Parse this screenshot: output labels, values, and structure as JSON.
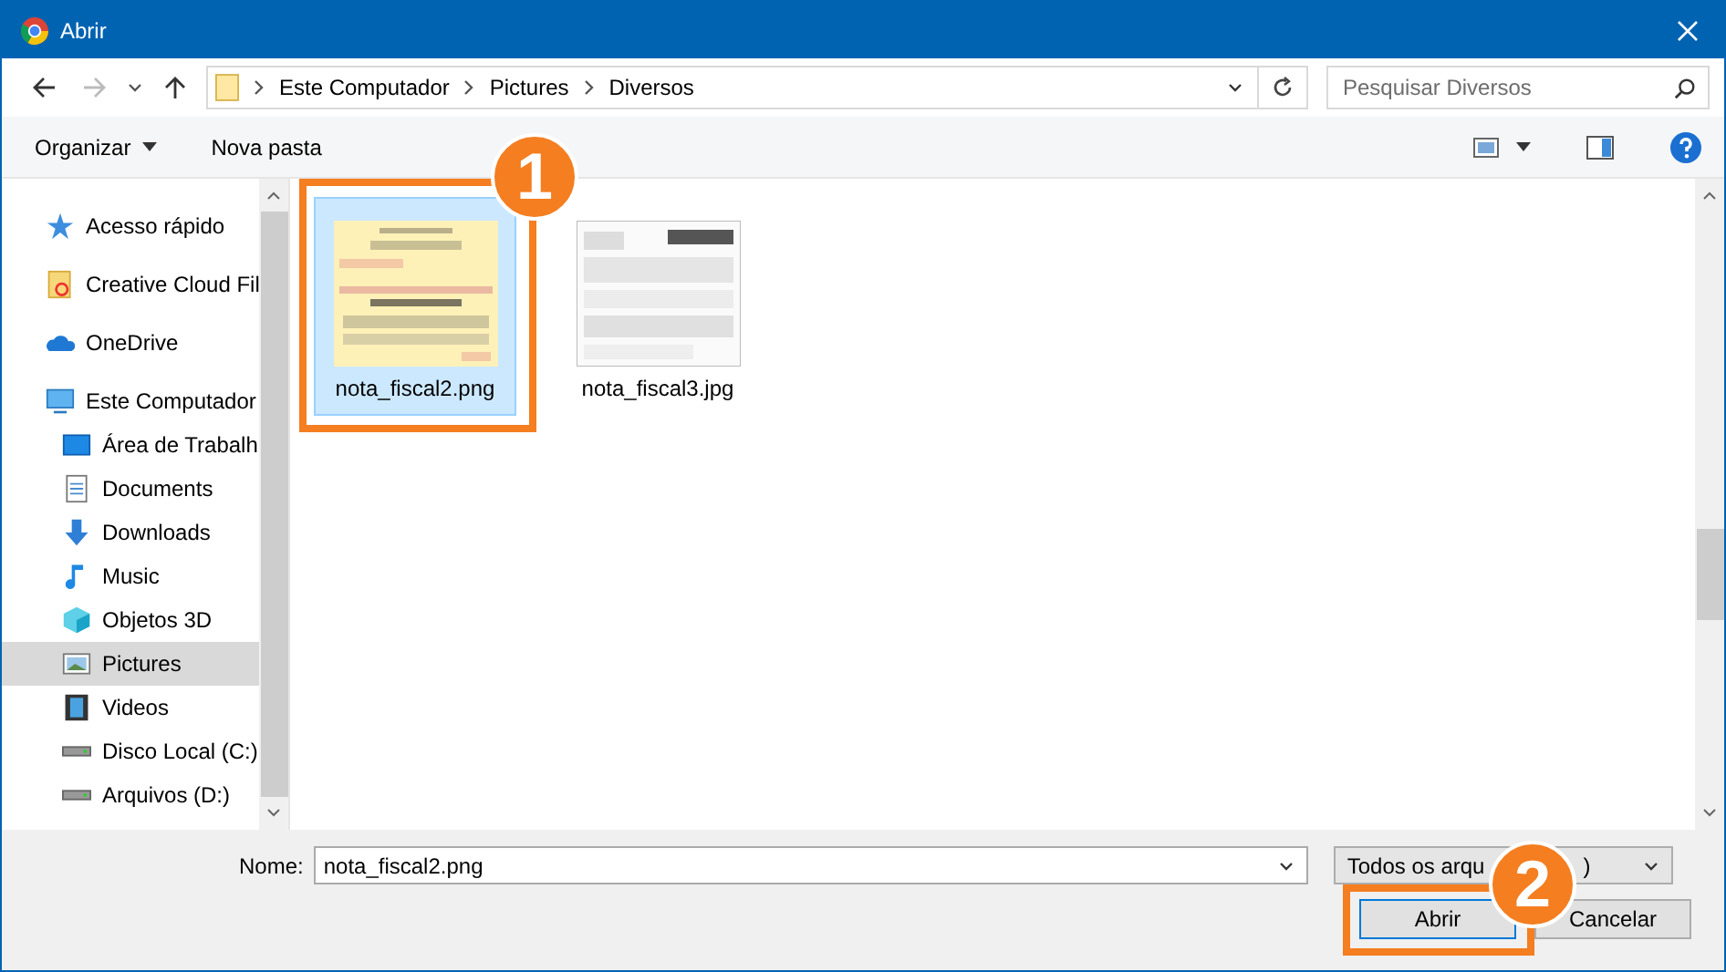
{
  "window": {
    "title": "Abrir"
  },
  "address": {
    "crumbs": [
      "Este Computador",
      "Pictures",
      "Diversos"
    ]
  },
  "search": {
    "placeholder": "Pesquisar Diversos"
  },
  "toolbar": {
    "organize": "Organizar",
    "new_folder": "Nova pasta"
  },
  "sidebar": {
    "items": [
      {
        "label": "Acesso rápido",
        "selected": false
      },
      {
        "label": "Creative Cloud Fil",
        "selected": false
      },
      {
        "label": "OneDrive",
        "selected": false
      },
      {
        "label": "Este Computador",
        "selected": false,
        "children": [
          {
            "label": "Área de Trabalh",
            "selected": false
          },
          {
            "label": "Documents",
            "selected": false
          },
          {
            "label": "Downloads",
            "selected": false
          },
          {
            "label": "Music",
            "selected": false
          },
          {
            "label": "Objetos 3D",
            "selected": false
          },
          {
            "label": "Pictures",
            "selected": true
          },
          {
            "label": "Videos",
            "selected": false
          },
          {
            "label": "Disco Local (C:)",
            "selected": false
          },
          {
            "label": "Arquivos (D:)",
            "selected": false
          }
        ]
      }
    ]
  },
  "files": [
    {
      "name": "nota_fiscal2.png",
      "kind": "picture",
      "selected": true
    },
    {
      "name": "nota_fiscal3.jpg",
      "kind": "picture",
      "selected": false
    }
  ],
  "footer": {
    "name_label": "Nome:",
    "name_value": "nota_fiscal2.png",
    "filter": "Todos os arqu",
    "filter_tail": ")",
    "open": "Abrir",
    "cancel": "Cancelar"
  },
  "callouts": [
    {
      "number": "1"
    },
    {
      "number": "2"
    }
  ]
}
